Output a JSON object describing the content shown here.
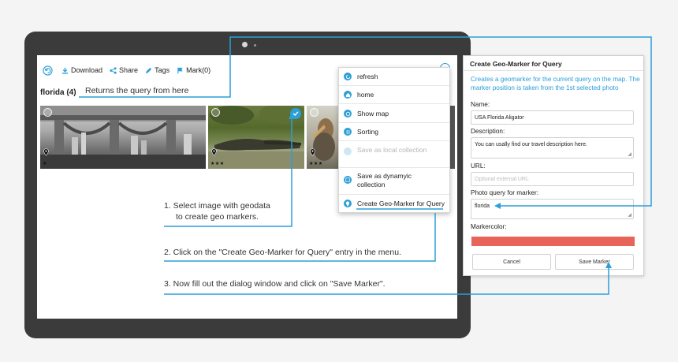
{
  "toolbar": {
    "download": "Download",
    "share": "Share",
    "tags": "Tags",
    "mark": "Mark(0)"
  },
  "gallery": {
    "query_title": "florida (4)",
    "thumbs": [
      {
        "stars": "★"
      },
      {
        "stars": "★★★"
      },
      {
        "stars": "★★★"
      }
    ]
  },
  "menu": {
    "items": [
      {
        "label": "refresh",
        "icon": "refresh-icon"
      },
      {
        "label": "home",
        "icon": "home-icon"
      },
      {
        "label": "Show map",
        "icon": "map-icon"
      },
      {
        "label": "Sorting",
        "icon": "sorting-icon"
      },
      {
        "label": "Save as local collection",
        "icon": "collection-icon"
      },
      {
        "label": "Save as dynamyic collection",
        "icon": "save-icon"
      },
      {
        "label": "Create Geo-Marker for Query",
        "icon": "geo-marker-icon"
      }
    ]
  },
  "dialog": {
    "title": "Create Geo-Marker for Query",
    "description": "Creates a geomarker for the current query on the map. The marker position is taken from the 1st selected photo",
    "name_label": "Name:",
    "name_value": "USA Florida Aligator",
    "description_label": "Description:",
    "description_value": "You can usally find our travel description here.",
    "url_label": "URL:",
    "url_placeholder": "Optional external URL",
    "query_label": "Photo query for marker:",
    "query_value": "florida",
    "color_label": "Markercolor:",
    "color_value": "#e8635a",
    "cancel": "Cancel",
    "save": "Save Marker"
  },
  "annotations": {
    "returns_query": "Returns the query from here",
    "step1_line1": "1.  Select image with geodata",
    "step1_line2": "to create geo markers.",
    "step2": "2.  Click on the \"Create Geo-Marker for Query\" entry in the menu.",
    "step3": "3.  Now fill out the dialog window and click on \"Save Marker\"."
  },
  "colors": {
    "accent": "#2a9fd8",
    "device": "#3b3b3b"
  }
}
